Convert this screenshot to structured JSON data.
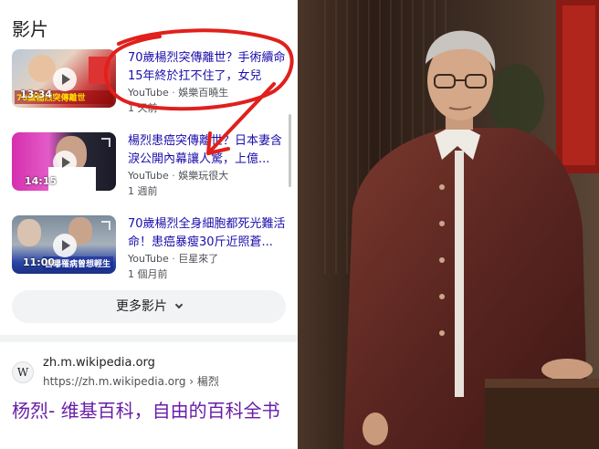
{
  "videos_section": {
    "title": "影片"
  },
  "videos": [
    {
      "title": "70歲楊烈突傳離世？手術續命15年終於扛不住了，女兒",
      "source": "YouTube",
      "channel": "娛樂百曉生",
      "age": "1 天前",
      "duration": "13:34",
      "thumb_caption": "70歲楊烈突傳離世"
    },
    {
      "title": "楊烈患癌突傳離世？日本妻含淚公開內幕讓人驚，上億...",
      "source": "YouTube",
      "channel": "娛樂玩很大",
      "age": "1 週前",
      "duration": "14:15",
      "thumb_caption": ""
    },
    {
      "title": "70歲楊烈全身細胞都死光難活命！患癌暴瘦30斤近照蒼...",
      "source": "YouTube",
      "channel": "巨星來了",
      "age": "1 個月前",
      "duration": "11:00",
      "thumb_caption": "自曝罹病曾想輕生"
    }
  ],
  "more_button": {
    "label": "更多影片"
  },
  "wiki_result": {
    "site": "zh.m.wikipedia.org",
    "url": "https://zh.m.wikipedia.org",
    "breadcrumb": "楊烈",
    "title": "杨烈- 维基百科，自由的百科全书",
    "logo_letter": "W"
  },
  "colors": {
    "link": "#1a0dab",
    "visited": "#681da8",
    "annotation_red": "#e0201c"
  },
  "icons": [
    "play-icon",
    "expand-icon",
    "chevron-down-icon",
    "wikipedia-icon"
  ]
}
